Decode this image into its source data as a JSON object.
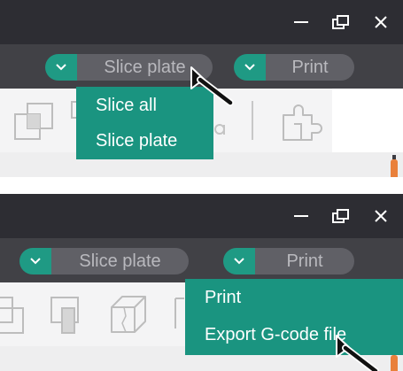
{
  "panel_top": {
    "window_controls": [
      "minimize-icon",
      "restore-icon",
      "close-icon"
    ],
    "toolbar": {
      "slice_button_label": "Slice plate",
      "print_button_label": "Print"
    },
    "dropdown_menu": {
      "items": [
        "Slice all",
        "Slice plate"
      ]
    }
  },
  "panel_bottom": {
    "window_controls": [
      "minimize-icon",
      "restore-icon",
      "close-icon"
    ],
    "toolbar": {
      "slice_button_label": "Slice plate",
      "print_button_label": "Print"
    },
    "dropdown_menu": {
      "items": [
        "Print",
        "Export G-code file"
      ]
    }
  },
  "colors": {
    "title_bar": "#2d2d33",
    "toolbar": "#414146",
    "accent": "#1f9a84",
    "menu_background": "#1a9480",
    "button_background": "#606066",
    "button_text": "#b9b9be",
    "marker": "#e9803b"
  }
}
